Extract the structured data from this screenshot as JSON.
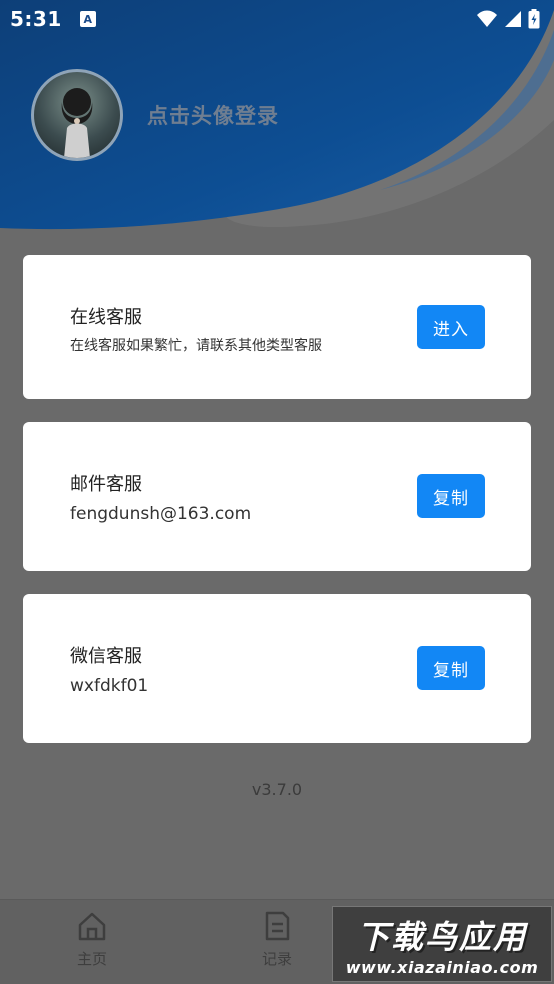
{
  "status_bar": {
    "time": "5:31",
    "notif_letter": "A"
  },
  "header": {
    "login_prompt": "点击头像登录"
  },
  "services": [
    {
      "title": "在线客服",
      "detail": "在线客服如果繁忙，请联系其他类型客服",
      "button": "进入"
    },
    {
      "title": "邮件客服",
      "detail": "fengdunsh@163.com",
      "button": "复制"
    },
    {
      "title": "微信客服",
      "detail": "wxfdkf01",
      "button": "复制"
    }
  ],
  "version": "v3.7.0",
  "bottom_nav": [
    {
      "label": "主页",
      "icon": "home-icon"
    },
    {
      "label": "记录",
      "icon": "document-icon"
    }
  ],
  "watermark": {
    "title": "下载鸟应用",
    "url": "www.xiazainiao.com"
  },
  "colors": {
    "header_blue": "#0d4e93",
    "button_blue": "#1287f5",
    "overlay_gray": "#6a6a6a"
  }
}
